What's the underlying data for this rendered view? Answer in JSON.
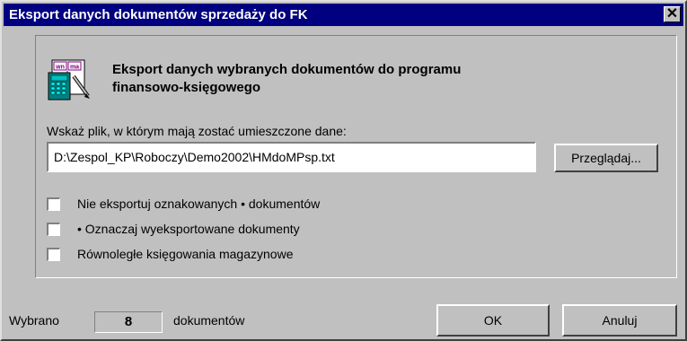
{
  "window": {
    "title": "Eksport danych dokumentów sprzedaży do FK",
    "close_glyph": "✕"
  },
  "header": {
    "line1": "Eksport danych wybranych dokumentów do programu",
    "line2": "finansowo-księgowego",
    "icon": "wn-ma-accounting-icon"
  },
  "file": {
    "prompt": "Wskaż plik, w którym mają zostać umieszczone dane:",
    "path": "D:\\Zespol_KP\\Roboczy\\Demo2002\\HMdoMPsp.txt",
    "browse_label": "Przeglądaj..."
  },
  "options": [
    {
      "label": "Nie eksportuj oznakowanych • dokumentów",
      "checked": false
    },
    {
      "label": "• Oznaczaj wyeksportowane dokumenty",
      "checked": false
    },
    {
      "label": "Równoległe księgowania magazynowe",
      "checked": false
    }
  ],
  "footer": {
    "selected_prefix": "Wybrano",
    "selected_count": "8",
    "selected_suffix": "dokumentów",
    "ok_label": "OK",
    "cancel_label": "Anuluj"
  },
  "colors": {
    "titlebar": "#000080",
    "face": "#c0c0c0"
  }
}
